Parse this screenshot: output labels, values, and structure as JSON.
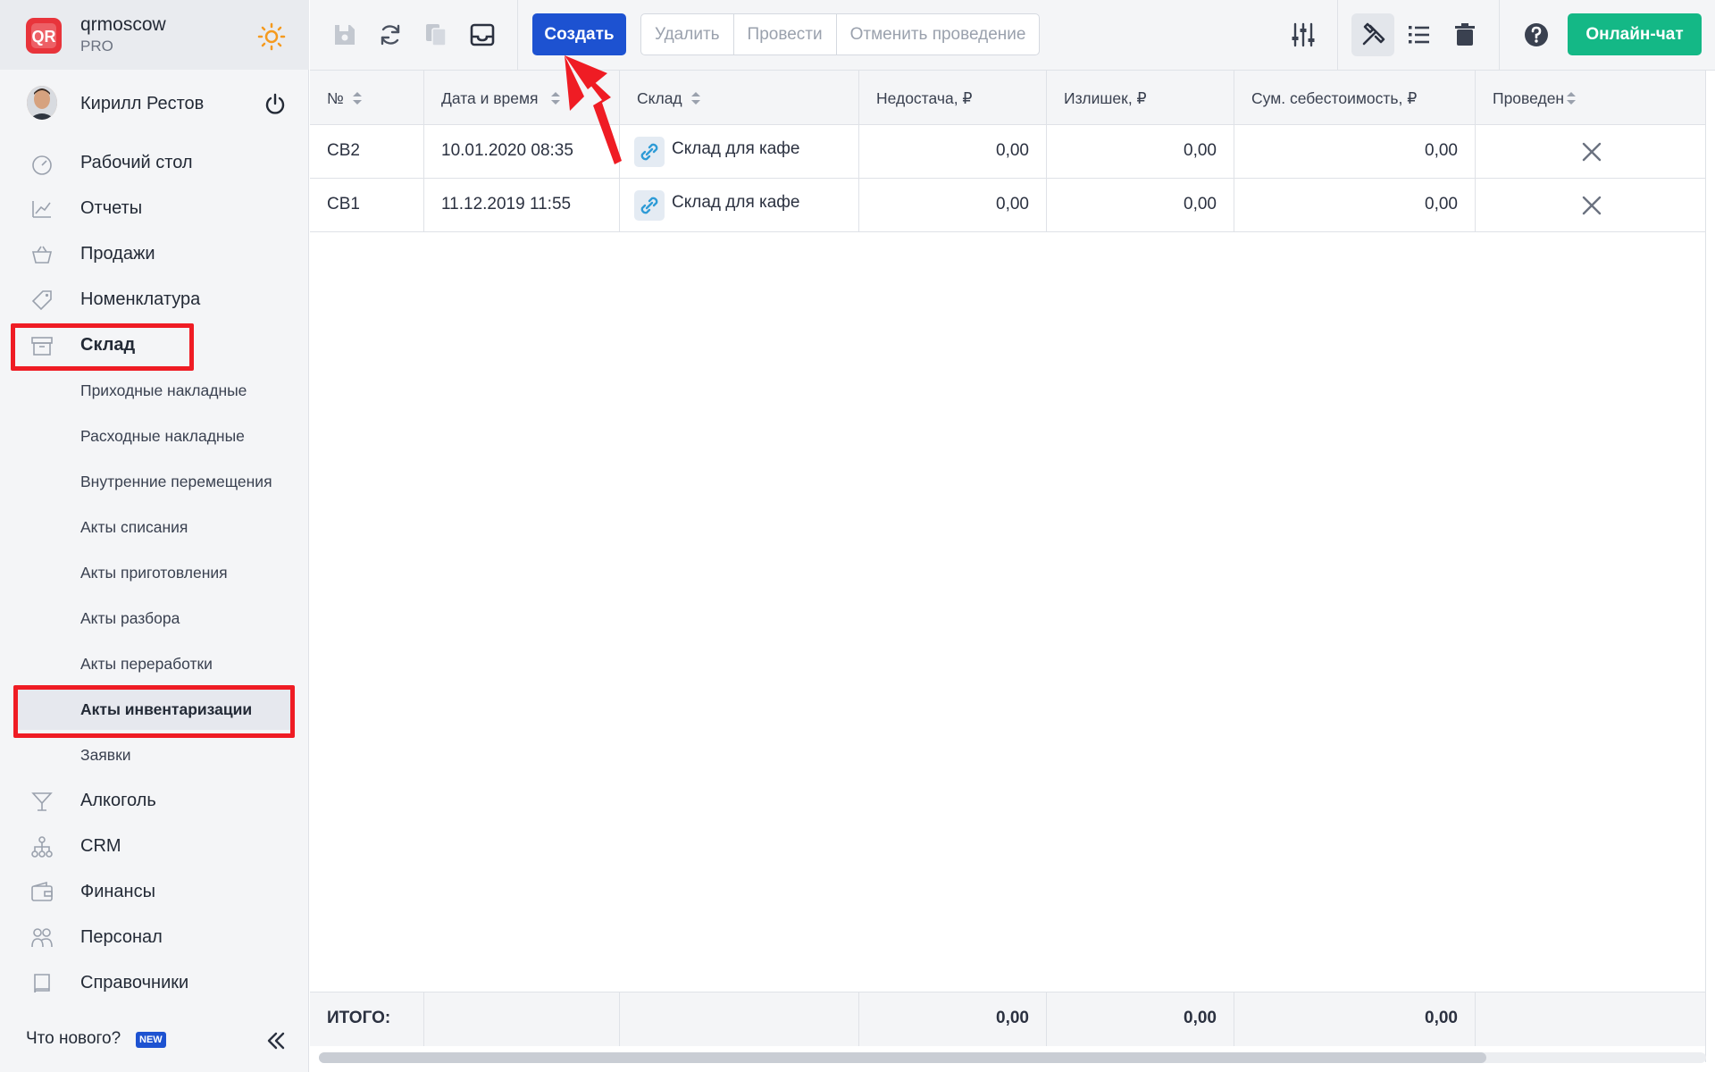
{
  "brand": {
    "name": "qrmoscow",
    "plan": "PRO",
    "logo_text": "QR"
  },
  "user": {
    "name": "Кирилл Рестов"
  },
  "nav": [
    {
      "label": "Рабочий стол",
      "icon": "dashboard-icon"
    },
    {
      "label": "Отчеты",
      "icon": "reports-icon"
    },
    {
      "label": "Продажи",
      "icon": "basket-icon"
    },
    {
      "label": "Номенклатура",
      "icon": "tag-icon"
    },
    {
      "label": "Склад",
      "icon": "archive-icon"
    },
    {
      "label": "Алкоголь",
      "icon": "cocktail-icon"
    },
    {
      "label": "CRM",
      "icon": "hierarchy-icon"
    },
    {
      "label": "Финансы",
      "icon": "wallet-icon"
    },
    {
      "label": "Персонал",
      "icon": "people-icon"
    },
    {
      "label": "Справочники",
      "icon": "book-icon"
    }
  ],
  "warehouse_sub": [
    {
      "label": "Приходные накладные"
    },
    {
      "label": "Расходные накладные"
    },
    {
      "label": "Внутренние перемещения"
    },
    {
      "label": "Акты списания"
    },
    {
      "label": "Акты приготовления"
    },
    {
      "label": "Акты разбора"
    },
    {
      "label": "Акты переработки"
    },
    {
      "label": "Акты инвентаризации"
    },
    {
      "label": "Заявки"
    }
  ],
  "sidebar_footer": {
    "whats_new": "Что нового?",
    "new_badge": "NEW"
  },
  "toolbar": {
    "create_label": "Создать",
    "delete_label": "Удалить",
    "post_label": "Провести",
    "unpost_label": "Отменить проведение",
    "chat_label": "Онлайн-чат"
  },
  "table": {
    "columns": [
      "№",
      "Дата и время",
      "Склад",
      "Недостача, ₽",
      "Излишек, ₽",
      "Сум. себестоимость, ₽",
      "Проведен"
    ],
    "rows": [
      {
        "number": "СВ2",
        "datetime": "10.01.2020 08:35",
        "warehouse": "Склад для кафе",
        "shortage": "0,00",
        "surplus": "0,00",
        "cost_sum": "0,00",
        "posted": false
      },
      {
        "number": "СВ1",
        "datetime": "11.12.2019 11:55",
        "warehouse": "Склад для кафе",
        "shortage": "0,00",
        "surplus": "0,00",
        "cost_sum": "0,00",
        "posted": false
      }
    ],
    "totals": {
      "label": "ИТОГО:",
      "shortage": "0,00",
      "surplus": "0,00",
      "cost_sum": "0,00"
    }
  },
  "colors": {
    "primary": "#1d52d1",
    "chat": "#14b886",
    "highlight": "#ef1c24",
    "logo": "#e8343b"
  }
}
